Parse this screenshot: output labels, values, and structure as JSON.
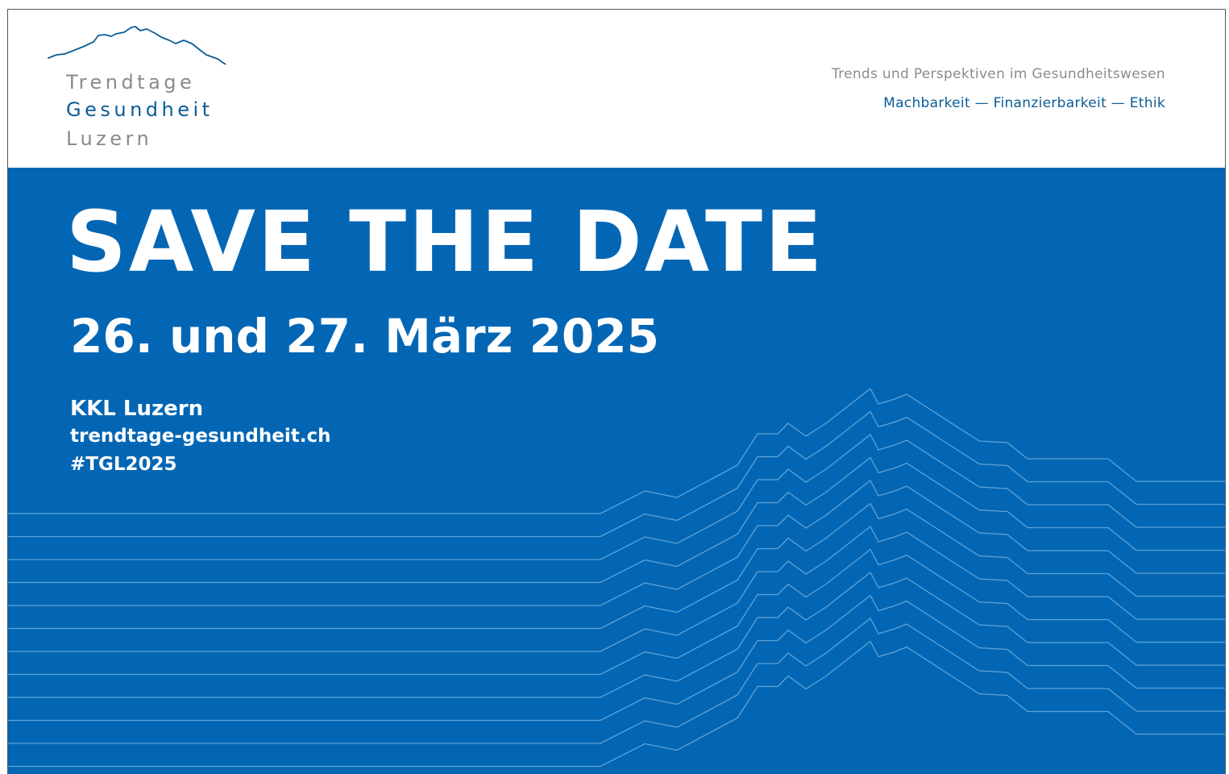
{
  "logo": {
    "line1": "Trendtage",
    "line2": "Gesundheit",
    "line3": "Luzern",
    "mountain_icon": "mountain-ridge-icon",
    "color_primary": "#0b5c97",
    "color_secondary": "#8a8a8a"
  },
  "header": {
    "tagline": "Trends und Perspektiven im Gesundheitswesen",
    "subtagline": "Machbarkeit — Finanzierbarkeit — Ethik"
  },
  "banner": {
    "headline": "SAVE THE DATE",
    "dates": "26. und 27. März 2025",
    "venue": "KKL Luzern",
    "website": "trendtage-gesundheit.ch",
    "hashtag": "#TGL2025",
    "background_color": "#0366b4",
    "pattern_icon": "mountain-wave-lines-icon"
  }
}
